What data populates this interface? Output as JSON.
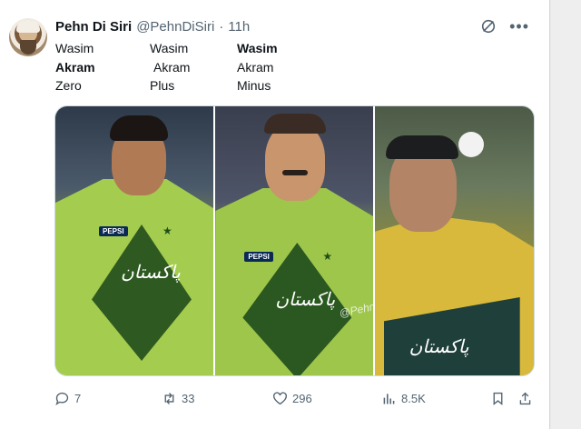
{
  "tweet": {
    "display_name": "Pehn Di Siri",
    "handle": "@PehnDiSiri",
    "separator": "·",
    "time": "11h",
    "lines": [
      [
        "Wasim",
        "Wasim",
        "Wasim"
      ],
      [
        "Akram",
        "Akram",
        "Akram"
      ],
      [
        "Zero",
        "Plus",
        "Minus"
      ]
    ],
    "watermark": "@PehnDiSiri",
    "jersey_text": "پاکستان",
    "pepsi_label": "PEPSI"
  },
  "actions": {
    "replies": "7",
    "reposts": "33",
    "likes": "296",
    "views": "8.5K"
  },
  "colors": {
    "text_primary": "#0f1419",
    "text_secondary": "#536471",
    "jersey_green": "#9dc04c",
    "jersey_dark": "#1f4d18"
  }
}
